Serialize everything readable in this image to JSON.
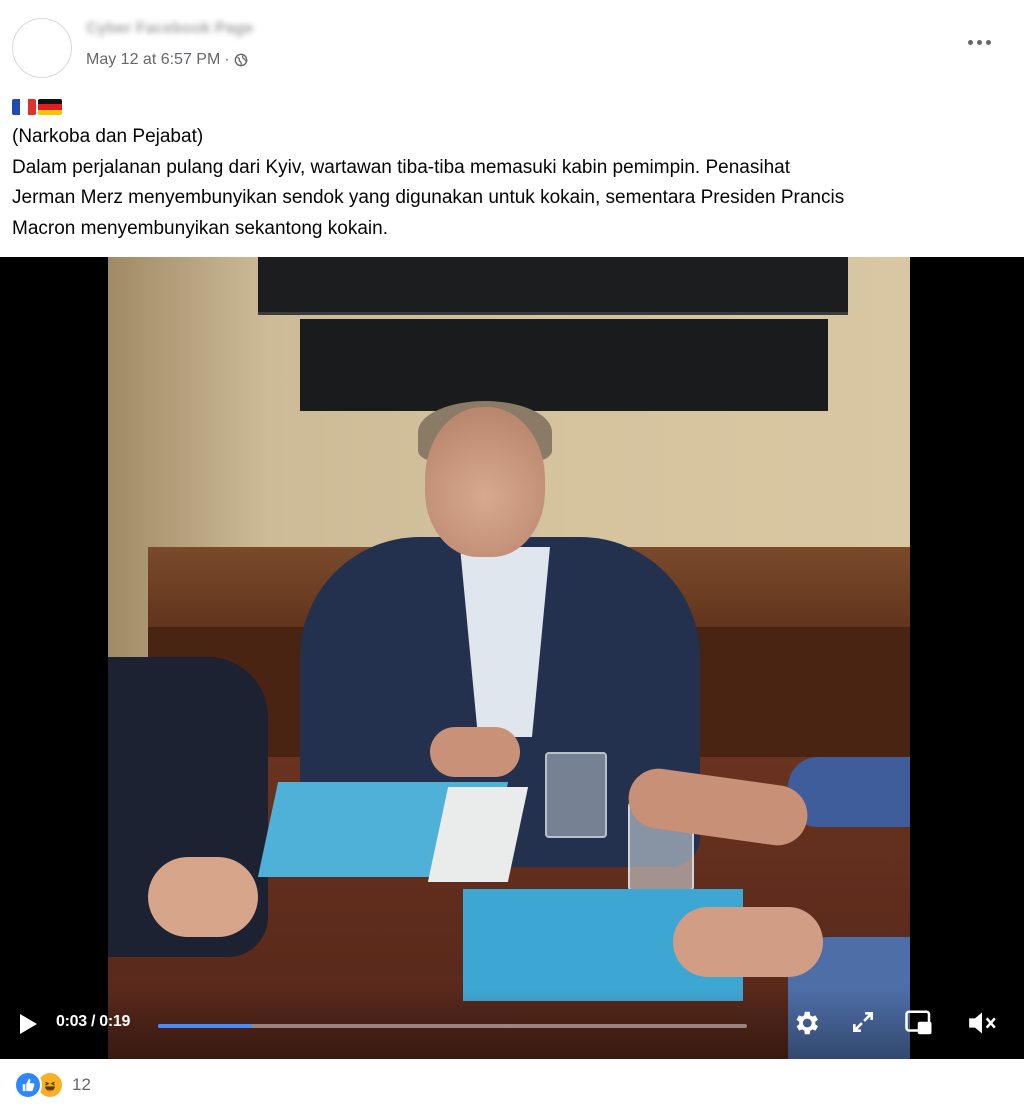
{
  "post": {
    "author_name": "Cyber Facebook Page",
    "timestamp": "May 12 at 6:57 PM",
    "separator": "·",
    "privacy_icon": "globe-icon",
    "flags": [
      "flag-france",
      "flag-germany"
    ],
    "text_lines": [
      "(Narkoba dan Pejabat)",
      "Dalam perjalanan pulang dari Kyiv, wartawan tiba-tiba memasuki kabin pemimpin. Penasihat",
      "Jerman Merz menyembunyikan sendok yang digunakan untuk kokain, sementara Presiden Prancis",
      "Macron menyembunyikan sekantong kokain."
    ]
  },
  "video": {
    "current_time": "0:03",
    "duration": "0:19",
    "time_separator": " / ",
    "progress_fraction": 0.16,
    "colors": {
      "progress": "#4c8bf5"
    }
  },
  "reactions": {
    "types": [
      "like-icon",
      "haha-icon"
    ],
    "count": "12"
  }
}
